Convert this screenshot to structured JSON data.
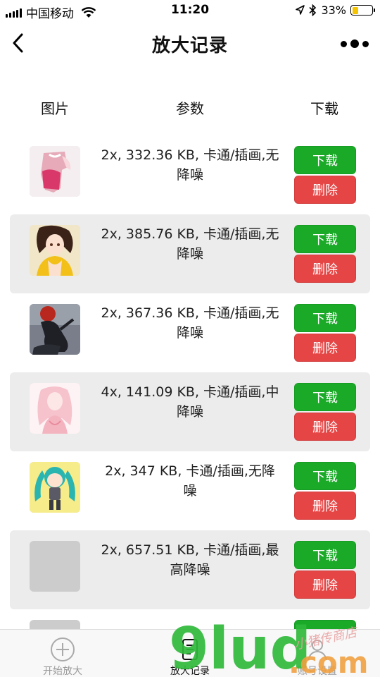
{
  "status_bar": {
    "carrier": "中国移动",
    "time": "11:20",
    "battery": "33%",
    "battery_level": 0.33
  },
  "nav": {
    "title": "放大记录"
  },
  "header": {
    "image": "图片",
    "params": "参数",
    "download": "下载"
  },
  "records": [
    {
      "params": "2x, 332.36 KB, 卡通/插画,无降噪",
      "download_label": "下载",
      "delete_label": "删除",
      "thumb": "pink-dress-figure"
    },
    {
      "params": "2x, 385.76 KB, 卡通/插画,无降噪",
      "download_label": "下载",
      "delete_label": "删除",
      "thumb": "anime-girl-yellow"
    },
    {
      "params": "2x, 367.36 KB, 卡通/插画,无降噪",
      "download_label": "下载",
      "delete_label": "删除",
      "thumb": "dark-figure-red-sky"
    },
    {
      "params": "4x, 141.09 KB, 卡通/插画,中降噪",
      "download_label": "下载",
      "delete_label": "删除",
      "thumb": "pink-sketch-girl"
    },
    {
      "params": "2x, 347 KB, 卡通/插画,无降噪",
      "download_label": "下载",
      "delete_label": "删除",
      "thumb": "teal-twin-tail-figure"
    },
    {
      "params": "2x, 657.51 KB, 卡通/插画,最高降噪",
      "download_label": "下载",
      "delete_label": "删除",
      "thumb": "blank"
    }
  ],
  "tabs": [
    {
      "label": "开始放大",
      "icon": "plus-circle-icon"
    },
    {
      "label": "放大记录",
      "icon": "document-icon"
    },
    {
      "label": "账号设置",
      "icon": "user-icon"
    }
  ],
  "watermark": {
    "brand": "9lud",
    "suffix": ".com",
    "script": "小猪传商店"
  },
  "colors": {
    "download": "#1aaa28",
    "delete": "#e54545",
    "alt_row": "#ececec",
    "battery": "#f5c400"
  }
}
